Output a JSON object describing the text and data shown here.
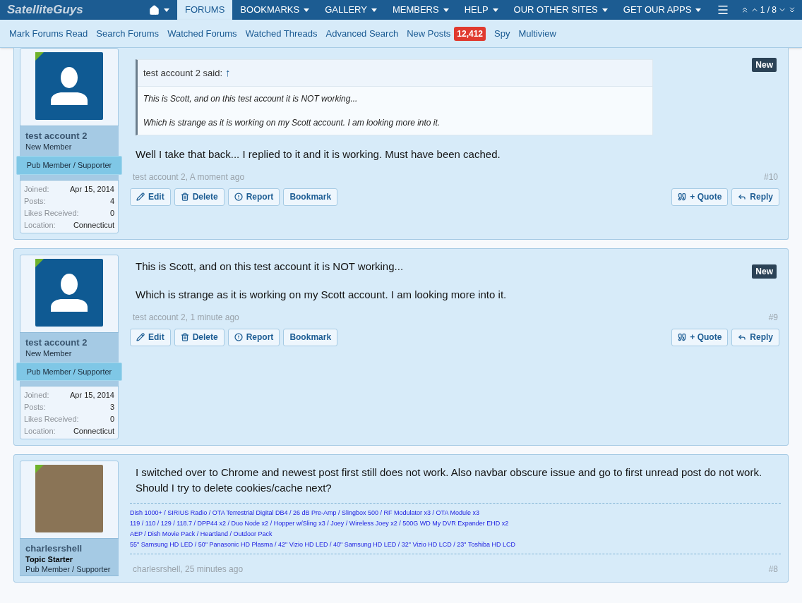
{
  "navbar": {
    "logo": "SatelliteGuys",
    "tabs": [
      {
        "kind": "home",
        "selected": false,
        "has_menu": true
      },
      {
        "kind": "text",
        "label": "FORUMS",
        "selected": true,
        "has_menu": false
      },
      {
        "kind": "text",
        "label": "BOOKMARKS",
        "selected": false,
        "has_menu": true
      },
      {
        "kind": "text",
        "label": "GALLERY",
        "selected": false,
        "has_menu": true
      },
      {
        "kind": "text",
        "label": "MEMBERS",
        "selected": false,
        "has_menu": true
      },
      {
        "kind": "text",
        "label": "HELP",
        "selected": false,
        "has_menu": true
      },
      {
        "kind": "text",
        "label": "OUR OTHER SITES",
        "selected": false,
        "has_menu": true
      },
      {
        "kind": "text",
        "label": "GET OUR APPS",
        "selected": false,
        "has_menu": true
      },
      {
        "kind": "menu",
        "selected": false,
        "has_menu": false
      }
    ],
    "pager": "1 / 8"
  },
  "subnav": [
    {
      "label": "Mark Forums Read"
    },
    {
      "label": "Search Forums"
    },
    {
      "label": "Watched Forums"
    },
    {
      "label": "Watched Threads"
    },
    {
      "label": "Advanced Search"
    },
    {
      "label": "New Posts",
      "badge": "12,412"
    },
    {
      "label": "Spy"
    },
    {
      "label": "Multiview"
    }
  ],
  "posts": [
    {
      "user": {
        "photo": false,
        "online": true,
        "name": "test account 2",
        "title": "New Member",
        "banner": "Pub Member / Supporter",
        "stats": [
          {
            "label": "Joined:",
            "value": "Apr 15, 2014"
          },
          {
            "label": "Posts:",
            "value": "4"
          },
          {
            "label": "Likes Received:",
            "value": "0"
          },
          {
            "label": "Location:",
            "value": "Connecticut"
          }
        ]
      },
      "is_new": true,
      "new_label": "New",
      "quote": {
        "author": "test account 2 said:",
        "arrow": "↑",
        "paragraphs": [
          "This is Scott, and on this test account it is NOT working...",
          "Which is strange as it is working on my Scott account. I am looking more into it."
        ]
      },
      "paragraphs": [
        "Well I take that back... I replied to it and it is working. Must have been cached."
      ],
      "meta": "test account 2, A moment ago",
      "number": "#10",
      "actions": [
        "Edit",
        "Delete",
        "Report",
        "Bookmark"
      ],
      "right_actions": [
        "+ Quote",
        "Reply"
      ]
    },
    {
      "user": {
        "photo": false,
        "online": true,
        "name": "test account 2",
        "title": "New Member",
        "banner": "Pub Member / Supporter",
        "stats": [
          {
            "label": "Joined:",
            "value": "Apr 15, 2014"
          },
          {
            "label": "Posts:",
            "value": "3"
          },
          {
            "label": "Likes Received:",
            "value": "0"
          },
          {
            "label": "Location:",
            "value": "Connecticut"
          }
        ]
      },
      "is_new": true,
      "new_label": "New",
      "paragraphs": [
        "This is Scott, and on this test account it is NOT working...",
        "Which is strange as it is working on my Scott account. I am looking more into it."
      ],
      "meta": "test account 2, 1 minute ago",
      "number": "#9",
      "actions": [
        "Edit",
        "Delete",
        "Report",
        "Bookmark"
      ],
      "right_actions": [
        "+ Quote",
        "Reply"
      ]
    },
    {
      "user": {
        "photo": true,
        "online": true,
        "name": "charlesrshell",
        "role": "Topic Starter",
        "title": "Pub Member / Supporter"
      },
      "is_new": false,
      "paragraphs": [
        "I switched over to Chrome and newest post first still does not work. Also navbar obscure issue and go to first unread post do not work. Should I try to delete cookies/cache next?"
      ],
      "signature": [
        "Dish 1000+ / SIRIUS Radio / OTA Terrestrial Digital DB4 / 26 dB Pre-Amp / Slingbox 500 / RF Modulator x3 / OTA Module x3",
        "119 / 110 / 129 / 118.7 / DPP44 x2 / Duo Node x2 / Hopper w/Sling x3 / Joey / Wireless Joey x2 / 500G WD My DVR Expander EHD x2",
        "AEP / Dish Movie Pack / Heartland / Outdoor Pack",
        "55\" Samsung HD LED / 50\" Panasonic HD Plasma / 42\" Vizio HD LED / 40\" Samsung HD LED / 32\" Vizio HD LCD / 23\" Toshiba HD LCD"
      ],
      "meta": "charlesrshell, 25 minutes ago",
      "number": "#8"
    }
  ]
}
